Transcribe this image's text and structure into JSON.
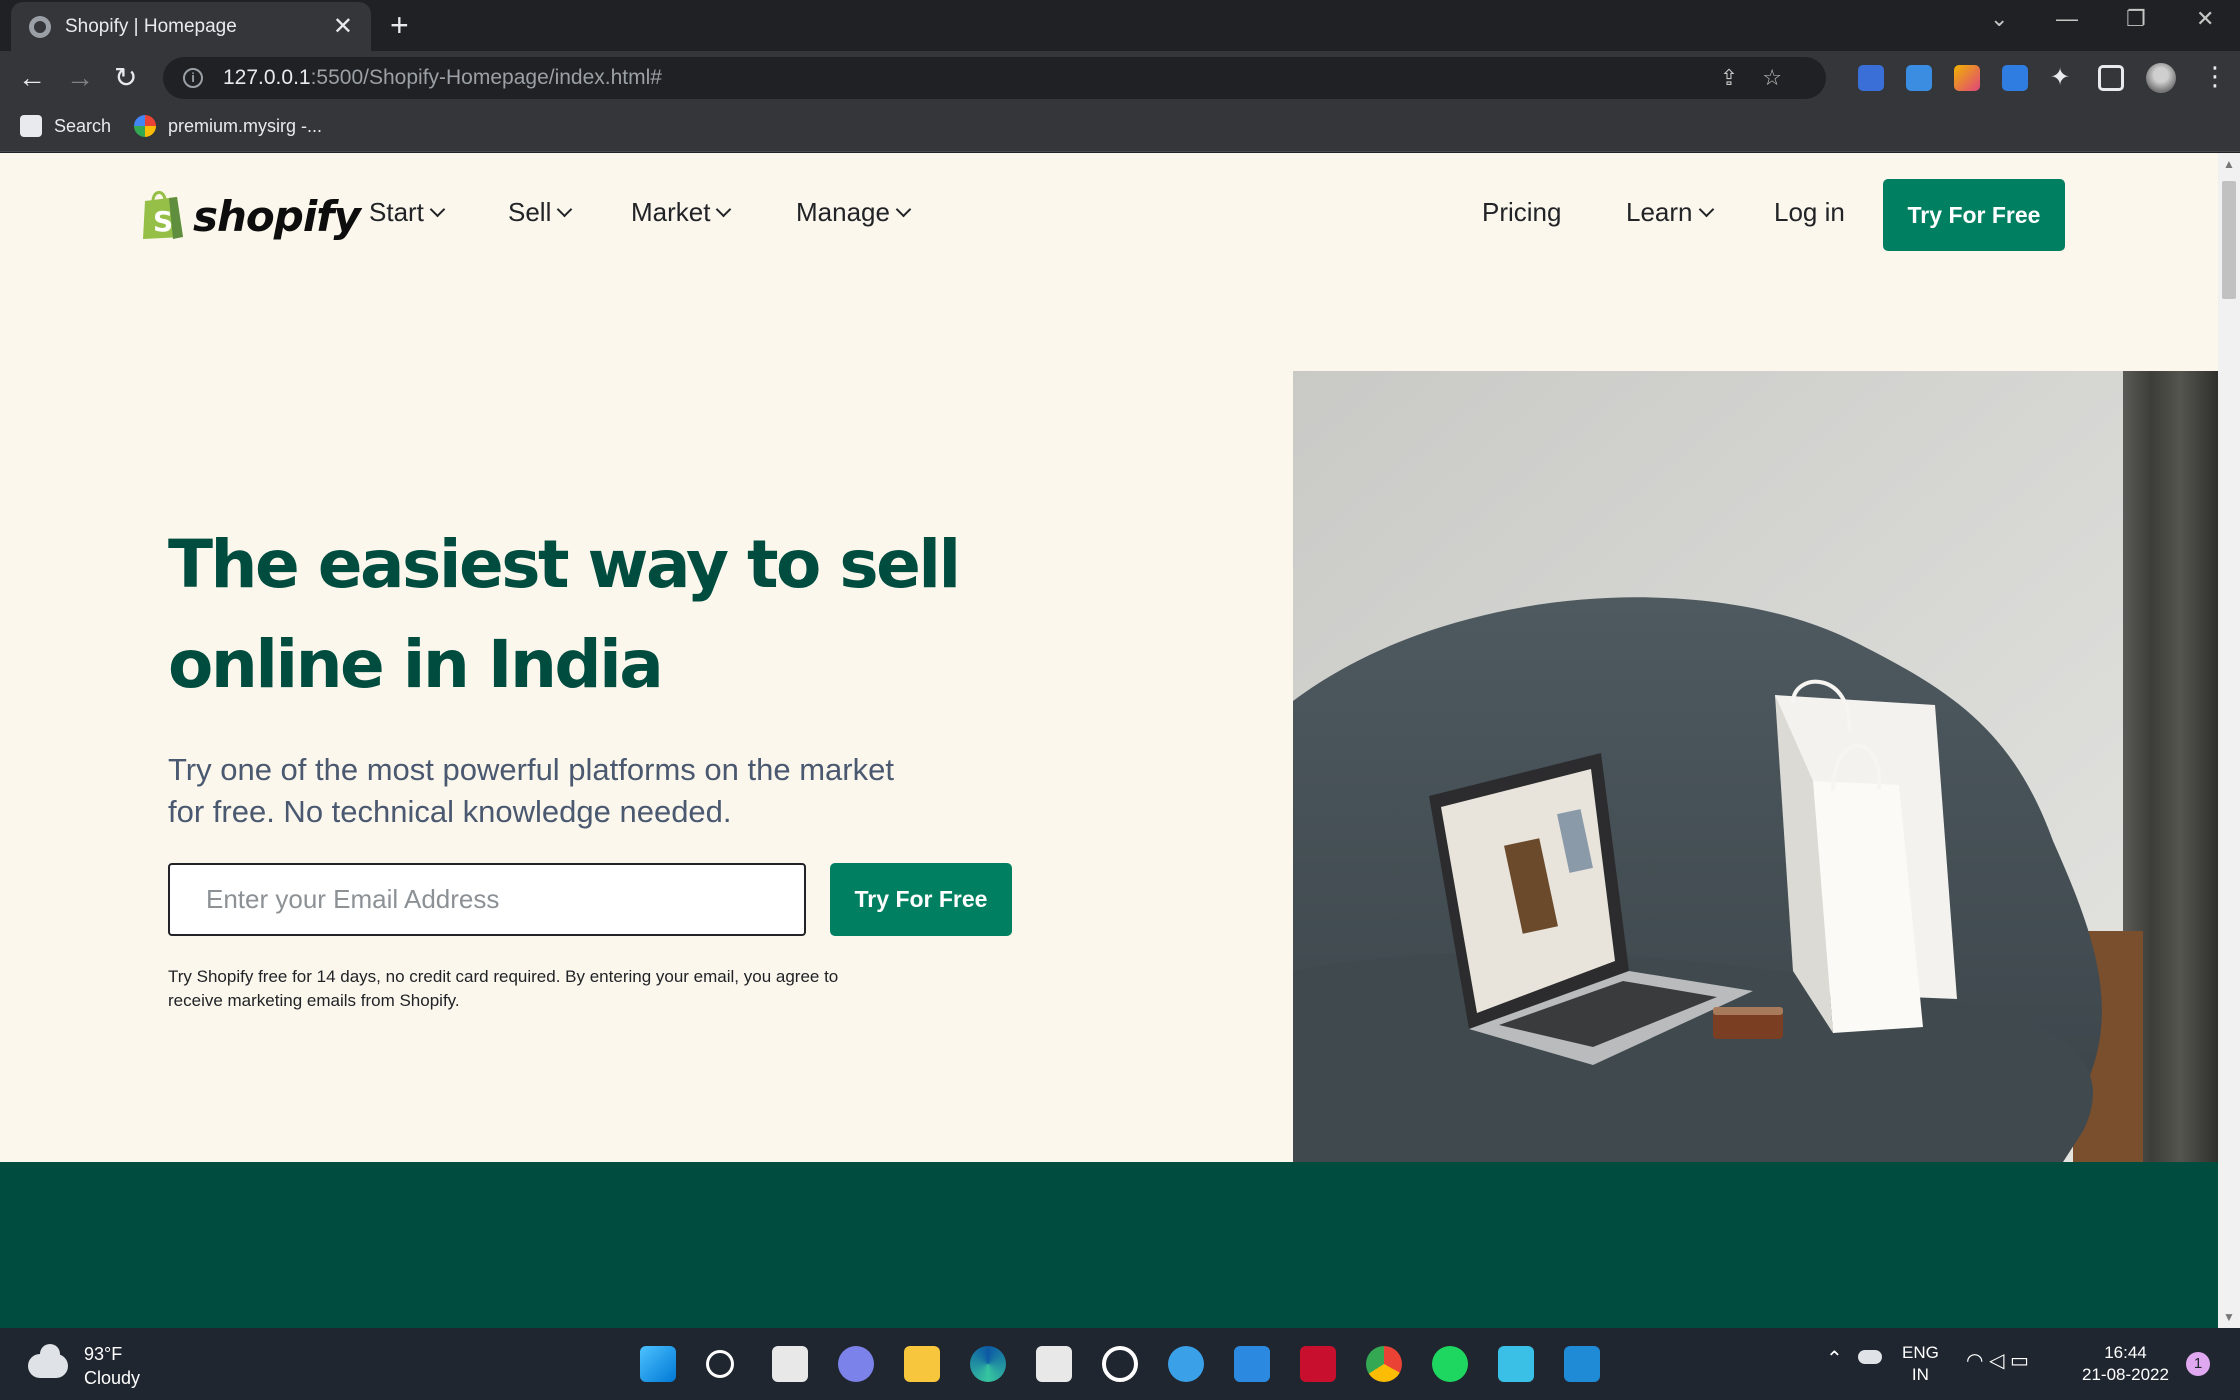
{
  "browser": {
    "tab_title": "Shopify | Homepage",
    "url_host": "127.0.0.1",
    "url_rest": ":5500/Shopify-Homepage/index.html#",
    "bookmarks": [
      "Search",
      "premium.mysirg -..."
    ]
  },
  "nav": {
    "logo_text": "shopify",
    "left_items": [
      "Start",
      "Sell",
      "Market",
      "Manage"
    ],
    "pricing": "Pricing",
    "learn": "Learn",
    "login": "Log in",
    "cta": "Try For Free"
  },
  "hero": {
    "title_line1": "The easiest way to sell",
    "title_line2": "online in India",
    "subtitle_line1": "Try one of the most powerful platforms on the market",
    "subtitle_line2": "for free. No technical knowledge needed.",
    "email_placeholder": "Enter your Email Address",
    "cta": "Try For Free",
    "note_line1": "Try Shopify free for 14 days, no credit card required. By entering your email, you agree to",
    "note_line2": "receive marketing emails from Shopify."
  },
  "taskbar": {
    "temp": "93°F",
    "weather": "Cloudy",
    "lang1": "ENG",
    "lang2": "IN",
    "time": "16:44",
    "date": "21-08-2022",
    "notifications": "1"
  },
  "colors": {
    "brand_green": "#008060",
    "dark_green": "#004c3f",
    "page_bg": "#fbf7ed"
  }
}
